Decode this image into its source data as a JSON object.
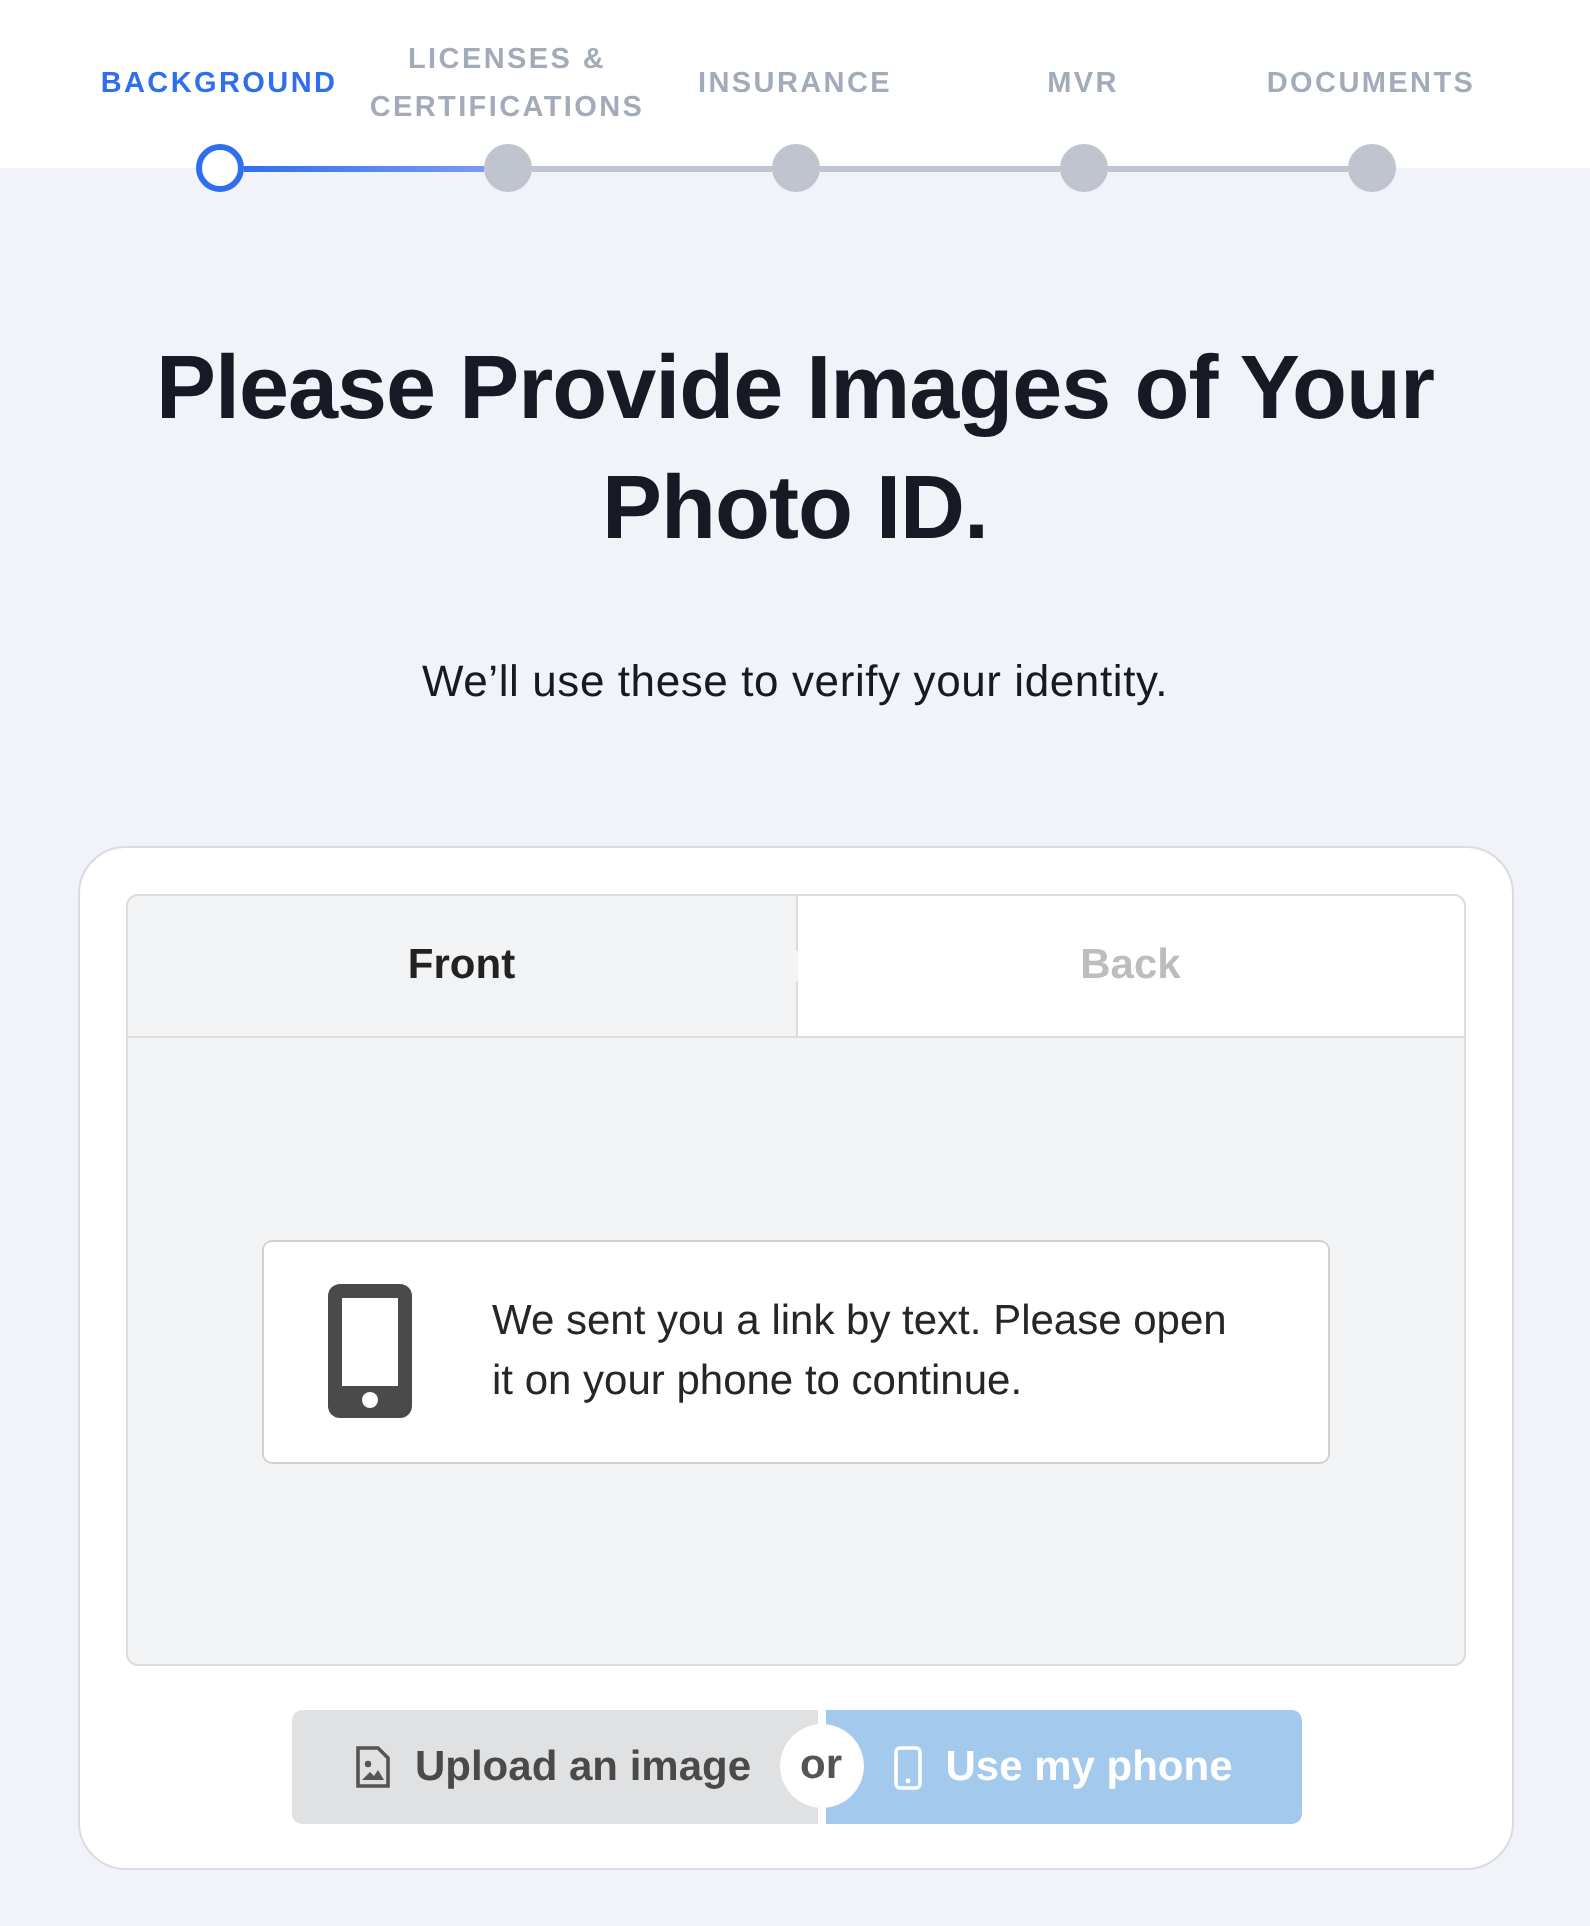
{
  "steps": [
    {
      "label": "BACKGROUND",
      "selected": true
    },
    {
      "label": "LICENSES & CERTIFICATIONS",
      "selected": false
    },
    {
      "label": "INSURANCE",
      "selected": false
    },
    {
      "label": "MVR",
      "selected": false
    },
    {
      "label": "DOCUMENTS",
      "selected": false
    }
  ],
  "title": "Please Provide Images of Your Photo ID.",
  "subtitle": "We’ll use these to verify your identity.",
  "tabs": [
    {
      "label": "Front",
      "selected": true
    },
    {
      "label": "Back",
      "selected": false
    }
  ],
  "message": "We sent you a link by text. Please open it on your phone to continue.",
  "buttons": [
    {
      "kind": "upload",
      "label": "Upload an image"
    },
    {
      "kind": "phone",
      "label": "Use my phone"
    }
  ],
  "separator": "or"
}
